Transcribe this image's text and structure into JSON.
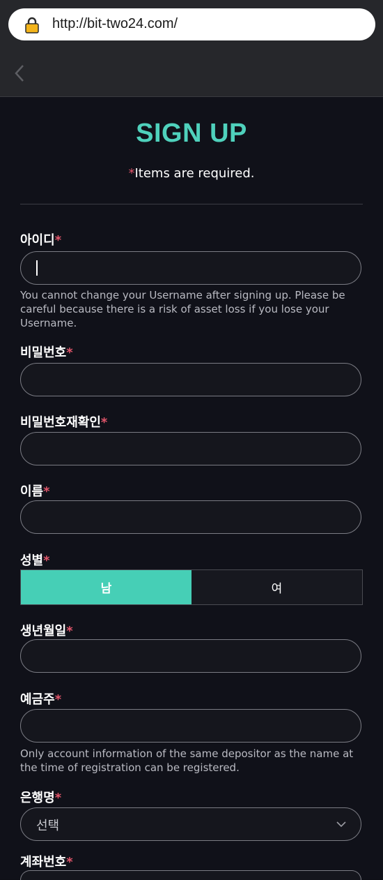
{
  "browser": {
    "url": "http://bit-two24.com/"
  },
  "header": {
    "title": "SIGN UP",
    "required_star": "*",
    "required_text": "Items are required."
  },
  "fields": {
    "username": {
      "label": "아이디",
      "star": "*",
      "help": "You cannot change your Username after signing up. Please be careful because there is a risk of asset loss if you lose your Username."
    },
    "password": {
      "label": "비밀번호",
      "star": "*"
    },
    "password_confirm": {
      "label": "비밀번호재확인",
      "star": "*"
    },
    "name": {
      "label": "이름",
      "star": "*"
    },
    "gender": {
      "label": "성별",
      "star": "*",
      "male": "남",
      "female": "여",
      "selected": "남"
    },
    "birth": {
      "label": "생년월일",
      "star": "*"
    },
    "depositor": {
      "label": "예금주",
      "star": "*",
      "help": "Only account information of the same depositor as the name at the time of registration can be registered."
    },
    "bank": {
      "label": "은행명",
      "star": "*",
      "value": "선택"
    },
    "account": {
      "label": "계좌번호",
      "star": "*"
    }
  },
  "colors": {
    "accent": "#4fd1bc",
    "required": "#e0556a",
    "background": "#101119"
  }
}
